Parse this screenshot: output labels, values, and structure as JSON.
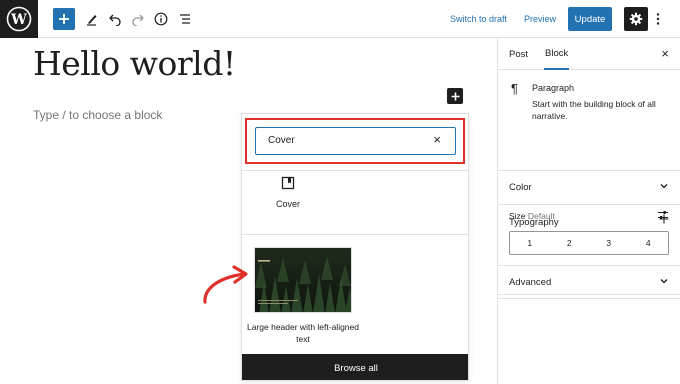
{
  "toolbar": {
    "switch_to_draft": "Switch to draft",
    "preview": "Preview",
    "update": "Update"
  },
  "editor": {
    "title": "Hello world!",
    "placeholder": "Type / to choose a block"
  },
  "inserter": {
    "search_value": "Cover",
    "block_label": "Cover",
    "pattern_label": "Large header with left-aligned text",
    "browse_all": "Browse all"
  },
  "sidebar": {
    "tab_post": "Post",
    "tab_block": "Block",
    "block_name": "Paragraph",
    "block_description": "Start with the building block of all narrative.",
    "panels": {
      "color": "Color",
      "typography": "Typography",
      "advanced": "Advanced"
    },
    "size_label": "Size",
    "size_default": "Default",
    "size_options": [
      "1",
      "2",
      "3",
      "4"
    ]
  },
  "colors": {
    "accent": "#2271b1",
    "dark": "#1e1e1e",
    "highlight": "#e0302a"
  }
}
